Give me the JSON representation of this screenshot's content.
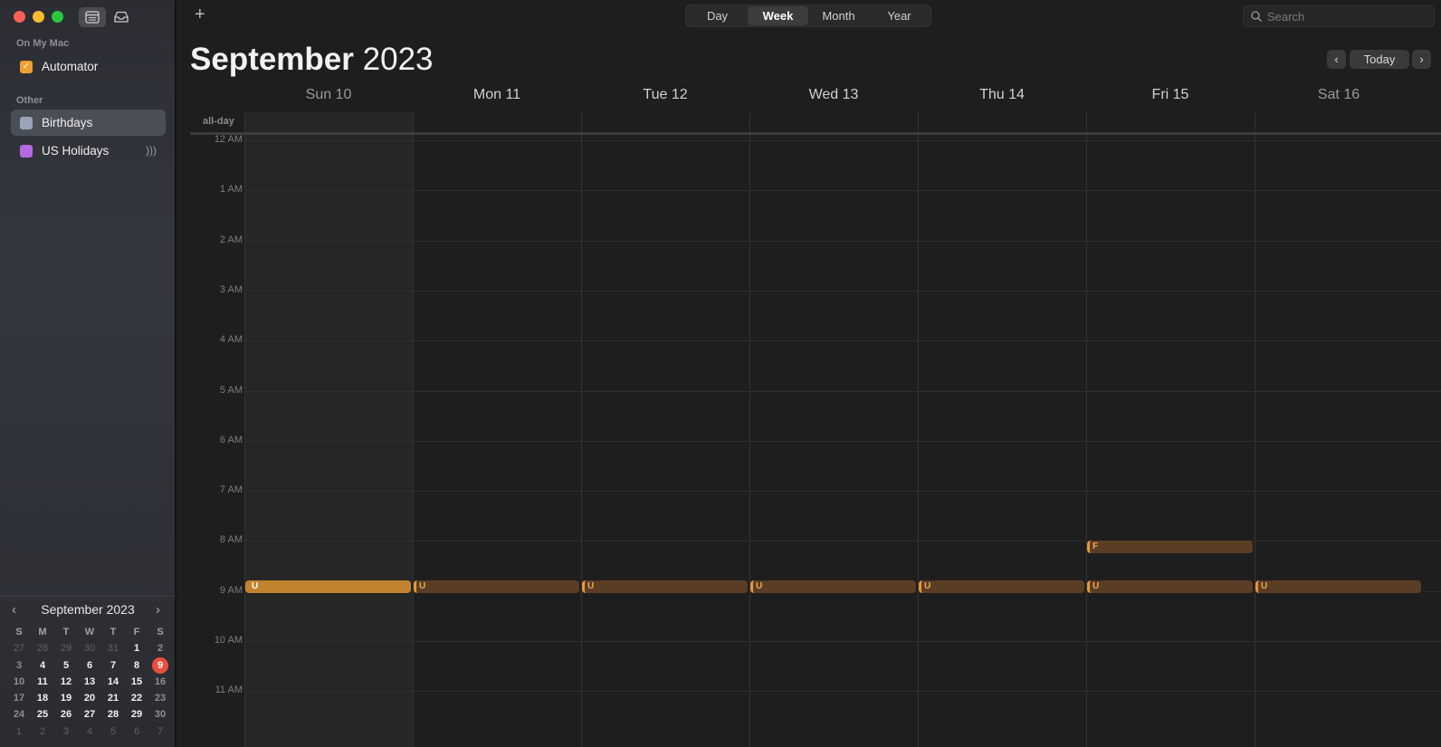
{
  "sidebar": {
    "section_on_my_mac": "On My Mac",
    "section_other": "Other",
    "calendars": [
      {
        "label": "Automator",
        "color": "#f0a030",
        "checked": true
      },
      {
        "label": "Birthdays",
        "color": "#9aa4b8",
        "checked": false
      },
      {
        "label": "US Holidays",
        "color": "#b56adf",
        "checked": false
      }
    ]
  },
  "mini_calendar": {
    "title": "September 2023",
    "weekdays": [
      "S",
      "M",
      "T",
      "W",
      "T",
      "F",
      "S"
    ],
    "weeks": [
      [
        "27",
        "28",
        "29",
        "30",
        "31",
        "1",
        "2"
      ],
      [
        "3",
        "4",
        "5",
        "6",
        "7",
        "8",
        "9"
      ],
      [
        "10",
        "11",
        "12",
        "13",
        "14",
        "15",
        "16"
      ],
      [
        "17",
        "18",
        "19",
        "20",
        "21",
        "22",
        "23"
      ],
      [
        "24",
        "25",
        "26",
        "27",
        "28",
        "29",
        "30"
      ],
      [
        "1",
        "2",
        "3",
        "4",
        "5",
        "6",
        "7"
      ]
    ],
    "today": "9"
  },
  "toolbar": {
    "views": [
      "Day",
      "Week",
      "Month",
      "Year"
    ],
    "active_view": "Week",
    "search_placeholder": "Search",
    "today_label": "Today"
  },
  "header": {
    "month": "September",
    "year": "2023"
  },
  "week": {
    "days": [
      "Sun 10",
      "Mon 11",
      "Tue 12",
      "Wed 13",
      "Thu 14",
      "Fri 15",
      "Sat 16"
    ],
    "allday_label": "all-day",
    "hours": [
      "12 AM",
      "1 AM",
      "2 AM",
      "3 AM",
      "4 AM",
      "5 AM",
      "6 AM",
      "7 AM",
      "8 AM",
      "9 AM",
      "10 AM",
      "11 AM"
    ]
  },
  "events": [
    {
      "day": 0,
      "label": "U",
      "time": "9 AM",
      "highlighted": true
    },
    {
      "day": 1,
      "label": "U",
      "time": "9 AM"
    },
    {
      "day": 2,
      "label": "U",
      "time": "9 AM"
    },
    {
      "day": 3,
      "label": "U",
      "time": "9 AM"
    },
    {
      "day": 4,
      "label": "U",
      "time": "9 AM"
    },
    {
      "day": 5,
      "label": "F",
      "time": "8 AM"
    },
    {
      "day": 5,
      "label": "U",
      "time": "9 AM"
    },
    {
      "day": 6,
      "label": "U",
      "time": "9 AM"
    }
  ]
}
